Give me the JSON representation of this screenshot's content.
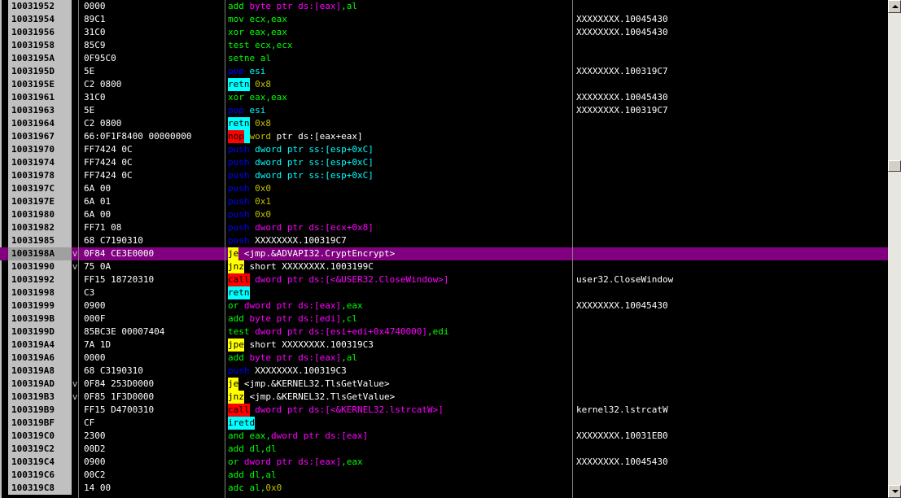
{
  "colors": {
    "white": "#ffffff",
    "yellow": "#ffff00",
    "lime": "#00ff00",
    "cyan": "#00ffff",
    "magenta": "#ff00ff",
    "blue": "#0000ff",
    "red": "#ff0000",
    "olive": "#c0c000",
    "selected_row": "#800080"
  },
  "scroll": {
    "position": 0.32
  },
  "rows": [
    {
      "addr": "10031952",
      "jmp": "",
      "hex": "0000",
      "asm": [
        {
          "t": "add ",
          "c": "lime"
        },
        {
          "t": "byte ptr ",
          "c": "magenta"
        },
        {
          "t": "ds:[eax]",
          "c": "magenta"
        },
        {
          "t": ",al",
          "c": "lime"
        }
      ],
      "cmt": ""
    },
    {
      "addr": "10031954",
      "jmp": "",
      "hex": "89C1",
      "asm": [
        {
          "t": "mov ",
          "c": "lime"
        },
        {
          "t": "ecx,eax",
          "c": "lime"
        }
      ],
      "cmt": "XXXXXXXX.10045430"
    },
    {
      "addr": "10031956",
      "jmp": "",
      "hex": "31C0",
      "asm": [
        {
          "t": "xor ",
          "c": "lime"
        },
        {
          "t": "eax,eax",
          "c": "lime"
        }
      ],
      "cmt": "XXXXXXXX.10045430"
    },
    {
      "addr": "10031958",
      "jmp": "",
      "hex": "85C9",
      "asm": [
        {
          "t": "test ",
          "c": "lime"
        },
        {
          "t": "ecx,ecx",
          "c": "lime"
        }
      ],
      "cmt": ""
    },
    {
      "addr": "1003195A",
      "jmp": "",
      "hex": "0F95C0",
      "asm": [
        {
          "t": "setne ",
          "c": "lime"
        },
        {
          "t": "al",
          "c": "lime"
        }
      ],
      "cmt": ""
    },
    {
      "addr": "1003195D",
      "jmp": "",
      "hex": "5E",
      "asm": [
        {
          "t": "pop ",
          "c": "blue"
        },
        {
          "t": "esi",
          "c": "cyan"
        }
      ],
      "cmt": "XXXXXXXX.100319C7"
    },
    {
      "addr": "1003195E",
      "jmp": "",
      "hex": "C2 0800",
      "asm": [
        {
          "t": "retn",
          "c": "black",
          "bg": "cyan"
        },
        {
          "t": " 0x8",
          "c": "olive"
        }
      ],
      "cmt": ""
    },
    {
      "addr": "10031961",
      "jmp": "",
      "hex": "31C0",
      "asm": [
        {
          "t": "xor ",
          "c": "lime"
        },
        {
          "t": "eax,eax",
          "c": "lime"
        }
      ],
      "cmt": "XXXXXXXX.10045430"
    },
    {
      "addr": "10031963",
      "jmp": "",
      "hex": "5E",
      "asm": [
        {
          "t": "pop ",
          "c": "blue"
        },
        {
          "t": "esi",
          "c": "cyan"
        }
      ],
      "cmt": "XXXXXXXX.100319C7"
    },
    {
      "addr": "10031964",
      "jmp": "",
      "hex": "C2 0800",
      "asm": [
        {
          "t": "retn",
          "c": "black",
          "bg": "cyan"
        },
        {
          "t": " 0x8",
          "c": "olive"
        }
      ],
      "cmt": ""
    },
    {
      "addr": "10031967",
      "jmp": "",
      "hex": "66:0F1F8400 00000000",
      "asm": [
        {
          "t": "nop",
          "c": "black",
          "bg": "red"
        },
        {
          "t": " ",
          "c": "white",
          "bg": "cyan"
        },
        {
          "t": "word",
          "c": "olive"
        },
        {
          "t": " ptr ds:[eax+eax]",
          "c": "white"
        }
      ],
      "cmt": ""
    },
    {
      "addr": "10031970",
      "jmp": "",
      "hex": "FF7424 0C",
      "asm": [
        {
          "t": "push ",
          "c": "blue"
        },
        {
          "t": "dword ptr ss:[esp+0xC]",
          "c": "cyan"
        }
      ],
      "cmt": ""
    },
    {
      "addr": "10031974",
      "jmp": "",
      "hex": "FF7424 0C",
      "asm": [
        {
          "t": "push ",
          "c": "blue"
        },
        {
          "t": "dword ptr ss:[esp+0xC]",
          "c": "cyan"
        }
      ],
      "cmt": ""
    },
    {
      "addr": "10031978",
      "jmp": "",
      "hex": "FF7424 0C",
      "asm": [
        {
          "t": "push ",
          "c": "blue"
        },
        {
          "t": "dword ptr ss:[esp+0xC]",
          "c": "cyan"
        }
      ],
      "cmt": ""
    },
    {
      "addr": "1003197C",
      "jmp": "",
      "hex": "6A 00",
      "asm": [
        {
          "t": "push ",
          "c": "blue"
        },
        {
          "t": "0x0",
          "c": "olive"
        }
      ],
      "cmt": ""
    },
    {
      "addr": "1003197E",
      "jmp": "",
      "hex": "6A 01",
      "asm": [
        {
          "t": "push ",
          "c": "blue"
        },
        {
          "t": "0x1",
          "c": "olive"
        }
      ],
      "cmt": ""
    },
    {
      "addr": "10031980",
      "jmp": "",
      "hex": "6A 00",
      "asm": [
        {
          "t": "push ",
          "c": "blue"
        },
        {
          "t": "0x0",
          "c": "olive"
        }
      ],
      "cmt": ""
    },
    {
      "addr": "10031982",
      "jmp": "",
      "hex": "FF71 08",
      "asm": [
        {
          "t": "push ",
          "c": "blue"
        },
        {
          "t": "dword ptr ds:[ecx+0x8]",
          "c": "magenta"
        }
      ],
      "cmt": ""
    },
    {
      "addr": "10031985",
      "jmp": "",
      "hex": "68 C7190310",
      "asm": [
        {
          "t": "push ",
          "c": "blue"
        },
        {
          "t": "XXXXXXXX.100319C7",
          "c": "white"
        }
      ],
      "cmt": ""
    },
    {
      "addr": "1003198A",
      "jmp": "v",
      "hex": "0F84 CE3E0000",
      "selected": true,
      "asm": [
        {
          "t": "je",
          "c": "black",
          "bg": "yellow"
        },
        {
          "t": " <jmp.&ADVAPI32.CryptEncrypt>",
          "c": "white"
        }
      ],
      "cmt": ""
    },
    {
      "addr": "10031990",
      "jmp": "v",
      "hex": "75 0A",
      "asm": [
        {
          "t": "jnz",
          "c": "black",
          "bg": "yellow"
        },
        {
          "t": " short XXXXXXXX.1003199C",
          "c": "white"
        }
      ],
      "cmt": ""
    },
    {
      "addr": "10031992",
      "jmp": "",
      "hex": "FF15 18720310",
      "asm": [
        {
          "t": "call",
          "c": "black",
          "bg": "red"
        },
        {
          "t": " dword ptr ds:[<&USER32.CloseWindow>]",
          "c": "magenta"
        }
      ],
      "cmt": "user32.CloseWindow"
    },
    {
      "addr": "10031998",
      "jmp": "",
      "hex": "C3",
      "asm": [
        {
          "t": "retn",
          "c": "black",
          "bg": "cyan"
        }
      ],
      "cmt": ""
    },
    {
      "addr": "10031999",
      "jmp": "",
      "hex": "0900",
      "asm": [
        {
          "t": "or ",
          "c": "lime"
        },
        {
          "t": "dword ptr ds:[eax]",
          "c": "magenta"
        },
        {
          "t": ",eax",
          "c": "lime"
        }
      ],
      "cmt": "XXXXXXXX.10045430"
    },
    {
      "addr": "1003199B",
      "jmp": "",
      "hex": "000F",
      "asm": [
        {
          "t": "add ",
          "c": "lime"
        },
        {
          "t": "byte ptr ds:[edi]",
          "c": "magenta"
        },
        {
          "t": ",cl",
          "c": "lime"
        }
      ],
      "cmt": ""
    },
    {
      "addr": "1003199D",
      "jmp": "",
      "hex": "85BC3E 00007404",
      "asm": [
        {
          "t": "test ",
          "c": "lime"
        },
        {
          "t": "dword ptr ds:[esi+edi+0x4740000]",
          "c": "magenta"
        },
        {
          "t": ",edi",
          "c": "lime"
        }
      ],
      "cmt": ""
    },
    {
      "addr": "100319A4",
      "jmp": "",
      "hex": "7A 1D",
      "asm": [
        {
          "t": "jpe",
          "c": "black",
          "bg": "yellow"
        },
        {
          "t": " short XXXXXXXX.100319C3",
          "c": "white"
        }
      ],
      "cmt": ""
    },
    {
      "addr": "100319A6",
      "jmp": "",
      "hex": "0000",
      "asm": [
        {
          "t": "add ",
          "c": "lime"
        },
        {
          "t": "byte ptr ds:[eax]",
          "c": "magenta"
        },
        {
          "t": ",al",
          "c": "lime"
        }
      ],
      "cmt": ""
    },
    {
      "addr": "100319A8",
      "jmp": "",
      "hex": "68 C3190310",
      "asm": [
        {
          "t": "push ",
          "c": "blue"
        },
        {
          "t": "XXXXXXXX.100319C3",
          "c": "white"
        }
      ],
      "cmt": ""
    },
    {
      "addr": "100319AD",
      "jmp": "v",
      "hex": "0F84 253D0000",
      "asm": [
        {
          "t": "je",
          "c": "black",
          "bg": "yellow"
        },
        {
          "t": " <jmp.&KERNEL32.TlsGetValue>",
          "c": "white"
        }
      ],
      "cmt": ""
    },
    {
      "addr": "100319B3",
      "jmp": "v",
      "hex": "0F85 1F3D0000",
      "asm": [
        {
          "t": "jnz",
          "c": "black",
          "bg": "yellow"
        },
        {
          "t": " <jmp.&KERNEL32.TlsGetValue>",
          "c": "white"
        }
      ],
      "cmt": ""
    },
    {
      "addr": "100319B9",
      "jmp": "",
      "hex": "FF15 D4700310",
      "asm": [
        {
          "t": "call",
          "c": "black",
          "bg": "red"
        },
        {
          "t": " dword ptr ds:[<&KERNEL32.lstrcatW>]",
          "c": "magenta"
        }
      ],
      "cmt": "kernel32.lstrcatW"
    },
    {
      "addr": "100319BF",
      "jmp": "",
      "hex": "CF",
      "asm": [
        {
          "t": "iretd",
          "c": "black",
          "bg": "cyan"
        }
      ],
      "cmt": ""
    },
    {
      "addr": "100319C0",
      "jmp": "",
      "hex": "2300",
      "asm": [
        {
          "t": "and ",
          "c": "lime"
        },
        {
          "t": "eax,",
          "c": "lime"
        },
        {
          "t": "dword ptr ds:[eax]",
          "c": "magenta"
        }
      ],
      "cmt": "XXXXXXXX.10031EB0"
    },
    {
      "addr": "100319C2",
      "jmp": "",
      "hex": "00D2",
      "asm": [
        {
          "t": "add ",
          "c": "lime"
        },
        {
          "t": "dl,dl",
          "c": "lime"
        }
      ],
      "cmt": ""
    },
    {
      "addr": "100319C4",
      "jmp": "",
      "hex": "0900",
      "asm": [
        {
          "t": "or ",
          "c": "lime"
        },
        {
          "t": "dword ptr ds:[eax]",
          "c": "magenta"
        },
        {
          "t": ",eax",
          "c": "lime"
        }
      ],
      "cmt": "XXXXXXXX.10045430"
    },
    {
      "addr": "100319C6",
      "jmp": "",
      "hex": "00C2",
      "asm": [
        {
          "t": "add ",
          "c": "lime"
        },
        {
          "t": "dl,al",
          "c": "lime"
        }
      ],
      "cmt": ""
    },
    {
      "addr": "100319C8",
      "jmp": "",
      "hex": "14 00",
      "asm": [
        {
          "t": "adc ",
          "c": "lime"
        },
        {
          "t": "al,",
          "c": "lime"
        },
        {
          "t": "0x0",
          "c": "olive"
        }
      ],
      "cmt": ""
    }
  ]
}
